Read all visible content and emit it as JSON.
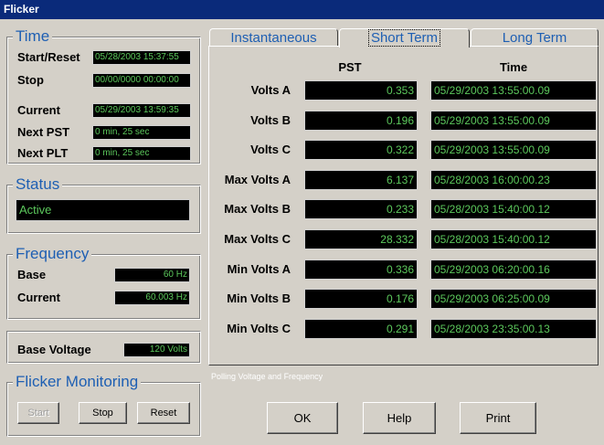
{
  "window": {
    "title": "Flicker"
  },
  "time": {
    "title": "Time",
    "start_reset_label": "Start/Reset",
    "start_reset_value": "05/28/2003 15:37:55",
    "stop_label": "Stop",
    "stop_value": "00/00/0000 00:00:00",
    "current_label": "Current",
    "current_value": "05/29/2003 13:59:35",
    "next_pst_label": "Next PST",
    "next_pst_value": "0 min, 25 sec",
    "next_plt_label": "Next PLT",
    "next_plt_value": "0 min, 25 sec"
  },
  "status": {
    "title": "Status",
    "value": "Active"
  },
  "frequency": {
    "title": "Frequency",
    "base_label": "Base",
    "base_value": "60 Hz",
    "current_label": "Current",
    "current_value": "60.003 Hz"
  },
  "base_voltage": {
    "label": "Base Voltage",
    "value": "120 Volts"
  },
  "flicker_monitoring": {
    "title": "Flicker Monitoring",
    "start_label": "Start",
    "stop_label": "Stop",
    "reset_label": "Reset"
  },
  "tabs": [
    {
      "label": "Instantaneous",
      "active": false
    },
    {
      "label": "Short Term",
      "active": true
    },
    {
      "label": "Long Term",
      "active": false
    }
  ],
  "table": {
    "headers": {
      "pst": "PST",
      "time": "Time"
    },
    "rows": [
      {
        "label": "Volts A",
        "pst": "0.353",
        "time": "05/29/2003 13:55:00.09"
      },
      {
        "label": "Volts B",
        "pst": "0.196",
        "time": "05/29/2003 13:55:00.09"
      },
      {
        "label": "Volts C",
        "pst": "0.322",
        "time": "05/29/2003 13:55:00.09"
      },
      {
        "label": "Max Volts A",
        "pst": "6.137",
        "time": "05/28/2003 16:00:00.23"
      },
      {
        "label": "Max Volts B",
        "pst": "0.233",
        "time": "05/28/2003 15:40:00.12"
      },
      {
        "label": "Max Volts C",
        "pst": "28.332",
        "time": "05/28/2003 15:40:00.12"
      },
      {
        "label": "Min Volts A",
        "pst": "0.336",
        "time": "05/29/2003 06:20:00.16"
      },
      {
        "label": "Min Volts B",
        "pst": "0.176",
        "time": "05/29/2003 06:25:00.09"
      },
      {
        "label": "Min Volts C",
        "pst": "0.291",
        "time": "05/28/2003 23:35:00.13"
      }
    ]
  },
  "status_bar": {
    "text": "Polling Voltage and Frequency"
  },
  "buttons": {
    "ok": "OK",
    "help": "Help",
    "print": "Print"
  },
  "colors": {
    "accent": "#1e5fb3",
    "lcd_text": "#5cc85c",
    "title_bar": "#0a2a7a"
  }
}
